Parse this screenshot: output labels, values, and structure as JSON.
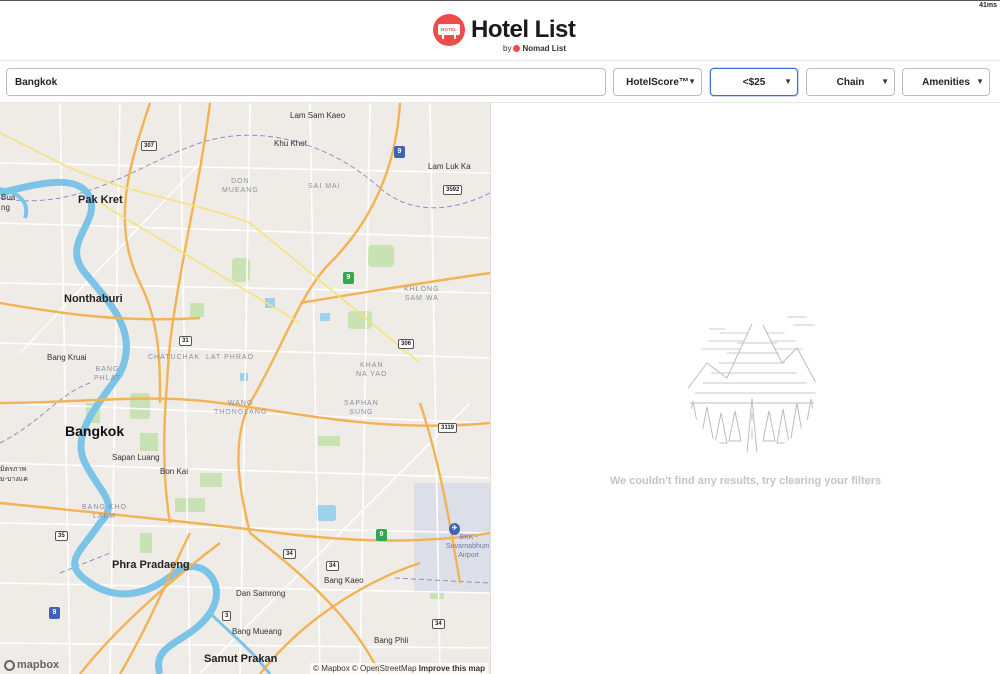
{
  "status": {
    "corner_badge": "41ms"
  },
  "header": {
    "logo_sign": "HOTEL",
    "title": "Hotel List",
    "byline_prefix": "by",
    "byline_brand": "Nomad List"
  },
  "filters": {
    "search_value": "Bangkok",
    "score": "HotelScore™",
    "price": "<$25",
    "chain": "Chain",
    "amenities": "Amenities"
  },
  "map": {
    "places": {
      "lam_sam_kaeo": "Lam Sam Kaeo",
      "khu_khot": "Khu Khot",
      "lam_luk_ka": "Lam Luk Ka",
      "pak_kret": "Pak Kret",
      "don_mueang": "DON\nMUEANG",
      "sai_mai": "SAI MAI",
      "bua": "Bua\nng",
      "khlong_sam_wa": "KHLONG\nSAM WA",
      "nonthaburi": "Nonthaburi",
      "bang_kruai": "Bang Kruai",
      "bang_phlat": "BANG\nPHLAT",
      "chatuchak": "CHATUCHAK",
      "lat_phrao": "LAT PHRAO",
      "khan_na_yao": "KHAN\nNA YAO",
      "saphan_sung": "SAPHAN\nSUNG",
      "wang_thonglang": "WANG\nTHONGLANG",
      "bangkok": "Bangkok",
      "sapan_luang": "Sapan Luang",
      "bon_kai": "Bon Kai",
      "left_edge_thai": "มิตรภาพ\nม-บางแค",
      "bang_kho_laem": "BANG KHO\nLAEM",
      "phra_pradaeng": "Phra Pradaeng",
      "bang_kaeo": "Bang Kaeo",
      "dan_samrong": "Dan Samrong",
      "bang_mueang": "Bang Mueang",
      "bang_phli": "Bang Phli",
      "samut_prakan": "Samut Prakan",
      "bkk": "BKK -\nSuvarnabhumi\nAirport"
    },
    "shields": [
      "307",
      "3592",
      "31",
      "306",
      "3119",
      "35",
      "34",
      "34",
      "3",
      "34"
    ],
    "expressway_numbers": [
      "9",
      "9",
      "9",
      "9"
    ],
    "mapbox_logo": "mapbox",
    "attribution": {
      "mapbox": "© Mapbox",
      "osm": "© OpenStreetMap",
      "improve": "Improve this map"
    },
    "colors": {
      "land": "#efece7",
      "water": "#7cc3e8",
      "major_road": "#f3b255",
      "minor_road": "#ffffff",
      "park": "#c8e2b4"
    }
  },
  "results": {
    "empty_message": "We couldn't find any results, try clearing your filters"
  }
}
